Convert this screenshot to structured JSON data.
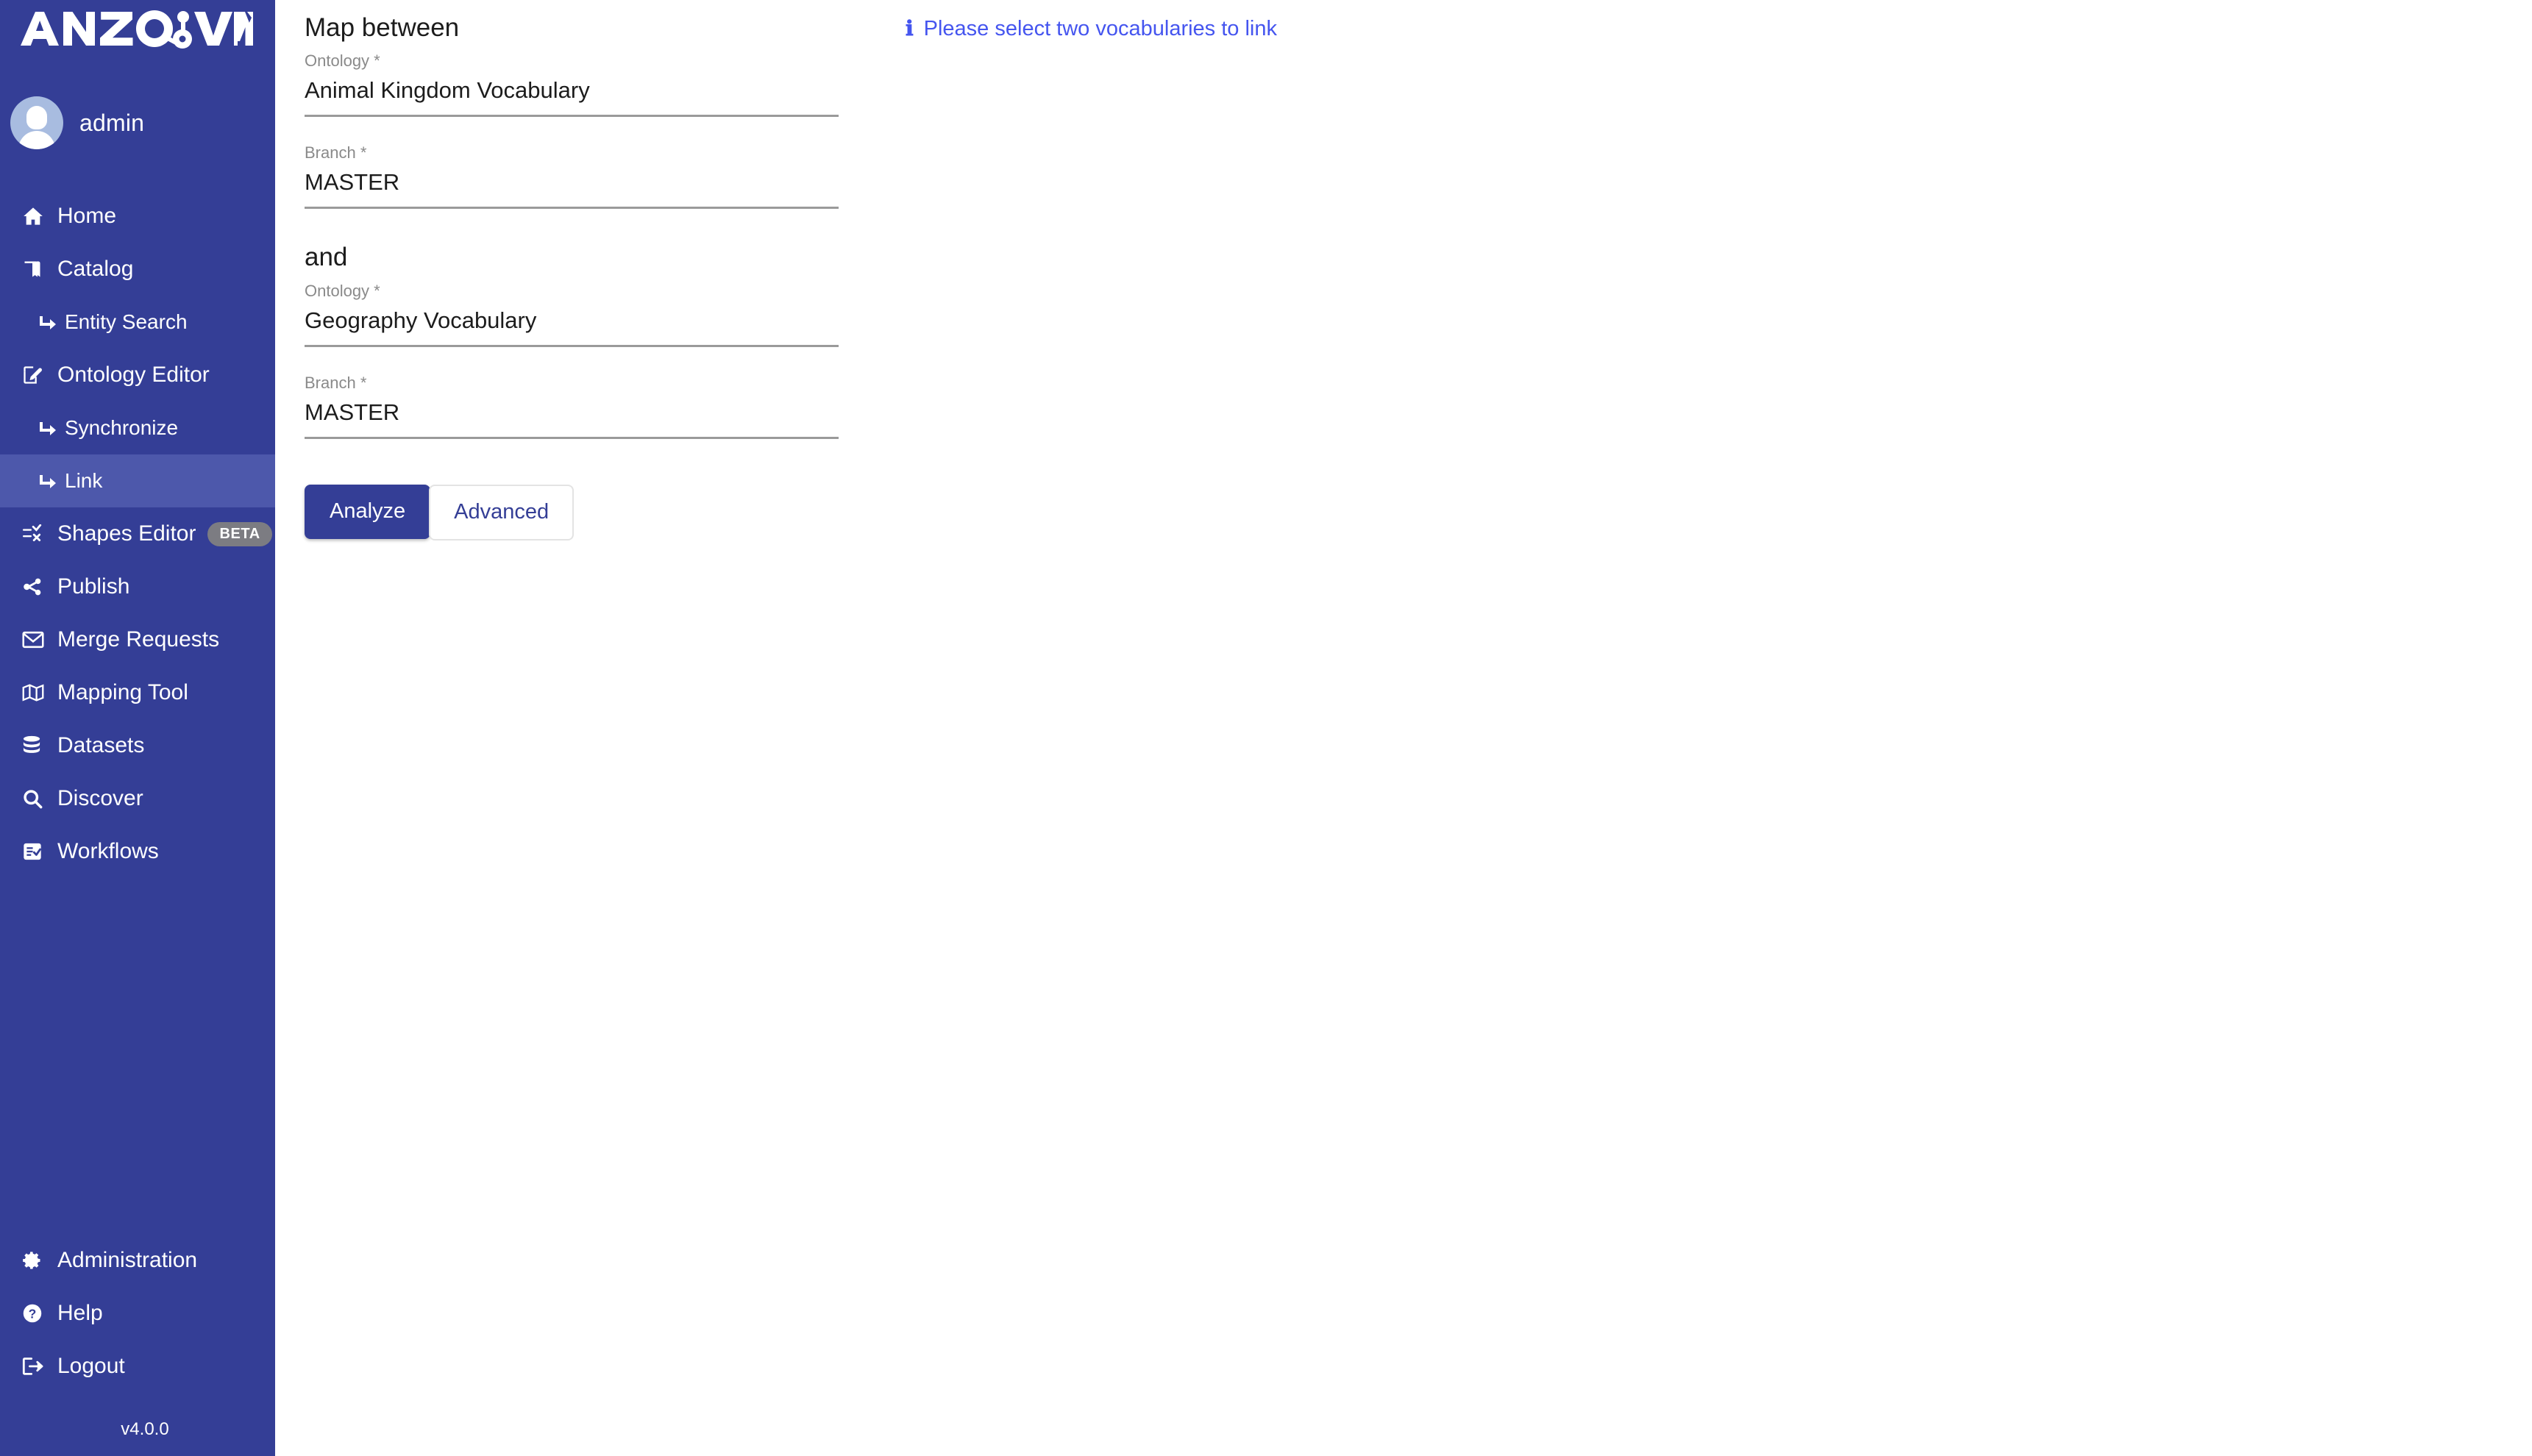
{
  "app": {
    "logo_text": "ANZO VM",
    "logo_part1": "ANZO",
    "logo_part2": "VM",
    "version": "v4.0.0"
  },
  "sidebar": {
    "user": {
      "name": "admin",
      "avatar_icon": "user-avatar-icon"
    },
    "items": [
      {
        "label": "Home",
        "icon": "home-icon",
        "sub": false,
        "active": false
      },
      {
        "label": "Catalog",
        "icon": "book-icon",
        "sub": false,
        "active": false
      },
      {
        "label": "Entity Search",
        "icon": "arrow-branch-icon",
        "sub": true,
        "active": false
      },
      {
        "label": "Ontology Editor",
        "icon": "edit-square-icon",
        "sub": false,
        "active": false
      },
      {
        "label": "Synchronize",
        "icon": "arrow-branch-icon",
        "sub": true,
        "active": false
      },
      {
        "label": "Link",
        "icon": "arrow-branch-icon",
        "sub": true,
        "active": true
      },
      {
        "label": "Shapes Editor",
        "icon": "shapes-filter-icon",
        "sub": false,
        "active": false,
        "badge": "BETA"
      },
      {
        "label": "Publish",
        "icon": "share-icon",
        "sub": false,
        "active": false
      },
      {
        "label": "Merge Requests",
        "icon": "envelope-icon",
        "sub": false,
        "active": false
      },
      {
        "label": "Mapping Tool",
        "icon": "map-icon",
        "sub": false,
        "active": false
      },
      {
        "label": "Datasets",
        "icon": "database-icon",
        "sub": false,
        "active": false
      },
      {
        "label": "Discover",
        "icon": "search-icon",
        "sub": false,
        "active": false
      },
      {
        "label": "Workflows",
        "icon": "checklist-icon",
        "sub": false,
        "active": false
      }
    ],
    "bottom_items": [
      {
        "label": "Administration",
        "icon": "gear-icon"
      },
      {
        "label": "Help",
        "icon": "question-circle-icon"
      },
      {
        "label": "Logout",
        "icon": "logout-icon"
      }
    ]
  },
  "main": {
    "map_between_title": "Map between",
    "and_title": "and",
    "source": {
      "ontology_label": "Ontology *",
      "ontology_value": "Animal Kingdom Vocabulary",
      "branch_label": "Branch *",
      "branch_value": "MASTER"
    },
    "target": {
      "ontology_label": "Ontology *",
      "ontology_value": "Geography Vocabulary",
      "branch_label": "Branch *",
      "branch_value": "MASTER"
    },
    "buttons": {
      "analyze": "Analyze",
      "advanced": "Advanced"
    },
    "info": {
      "icon": "info-icon",
      "icon_glyph": "ℹ",
      "text": "Please select two vocabularies to link",
      "color": "#4555ef"
    }
  },
  "colors": {
    "sidebar_bg": "#343e96",
    "sidebar_active": "#4d58ab",
    "primary": "#343e96",
    "info_blue": "#4555ef",
    "badge_gray": "#7c7c82",
    "field_underline": "#9a9a9a",
    "label_gray": "#8a8a8a"
  }
}
